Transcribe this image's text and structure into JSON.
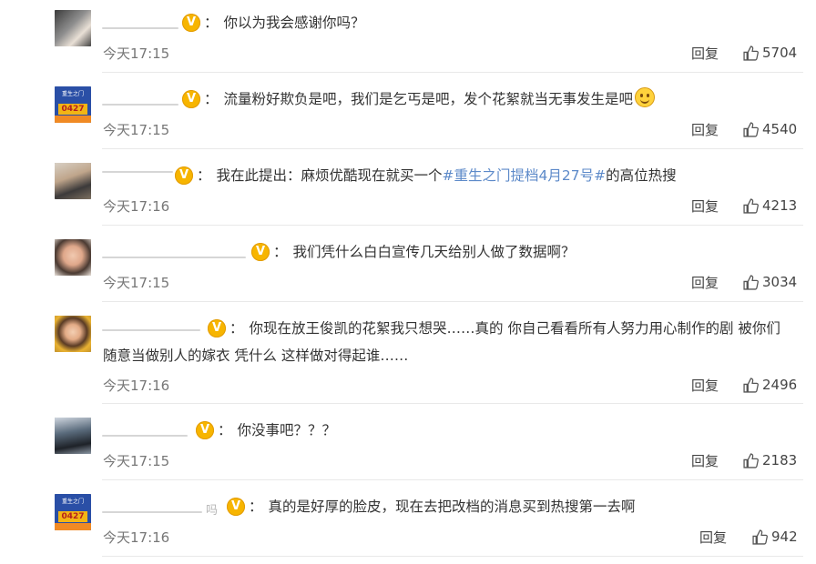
{
  "comments": [
    {
      "name_suffix": "",
      "badge": "V",
      "separator": "：",
      "text": "你以为我会感谢你吗？",
      "time": "今天17:15",
      "reply_label": "回复",
      "likes": "5704"
    },
    {
      "avatar_caption_top": "重生之门",
      "avatar_caption_number": "0427",
      "name_suffix": "",
      "badge": "V",
      "separator": "：",
      "text": "流量粉好欺负是吧，我们是乞丐是吧，发个花絮就当无事发生是吧",
      "emoji": "smile-emoji",
      "time": "今天17:15",
      "reply_label": "回复",
      "likes": "4540"
    },
    {
      "name_suffix": "",
      "badge": "V",
      "separator": "：",
      "text_before": "我在此提出：麻烦优酷现在就买一个",
      "topic": "#重生之门提档4月27号#",
      "text_after": "的高位热搜",
      "time": "今天17:16",
      "reply_label": "回复",
      "likes": "4213"
    },
    {
      "name_suffix": "",
      "badge": "V",
      "separator": "：",
      "text": "我们凭什么白白宣传几天给别人做了数据啊？",
      "time": "今天17:15",
      "reply_label": "回复",
      "likes": "3034"
    },
    {
      "name_suffix": "",
      "badge": "V",
      "separator": "：",
      "text_line1": "你现在放王俊凯的花絮我只想哭……真的 你自己看看所有人努力用心制作的剧 被你们",
      "text_line2": "随意当做别人的嫁衣 凭什么 这样做对得起谁……",
      "time": "今天17:16",
      "reply_label": "回复",
      "likes": "2496"
    },
    {
      "name_suffix": "",
      "badge": "V",
      "separator": "：",
      "text": "你没事吧？？？",
      "time": "今天17:15",
      "reply_label": "回复",
      "likes": "2183"
    },
    {
      "avatar_caption_top": "重生之门",
      "avatar_caption_number": "0427",
      "name_suffix": "吗",
      "badge": "V",
      "separator": "：",
      "text": "真的是好厚的脸皮，现在去把改档的消息买到热搜第一去啊",
      "time": "今天17:16",
      "reply_label": "回复",
      "likes": "942"
    }
  ],
  "icons": {
    "like": "thumbs-up-icon",
    "badge": "verified-v-badge"
  },
  "colors": {
    "badge": "#f7b500",
    "topic_link": "#5d8ac9",
    "time": "#777777",
    "divider": "#e9e9e9"
  }
}
